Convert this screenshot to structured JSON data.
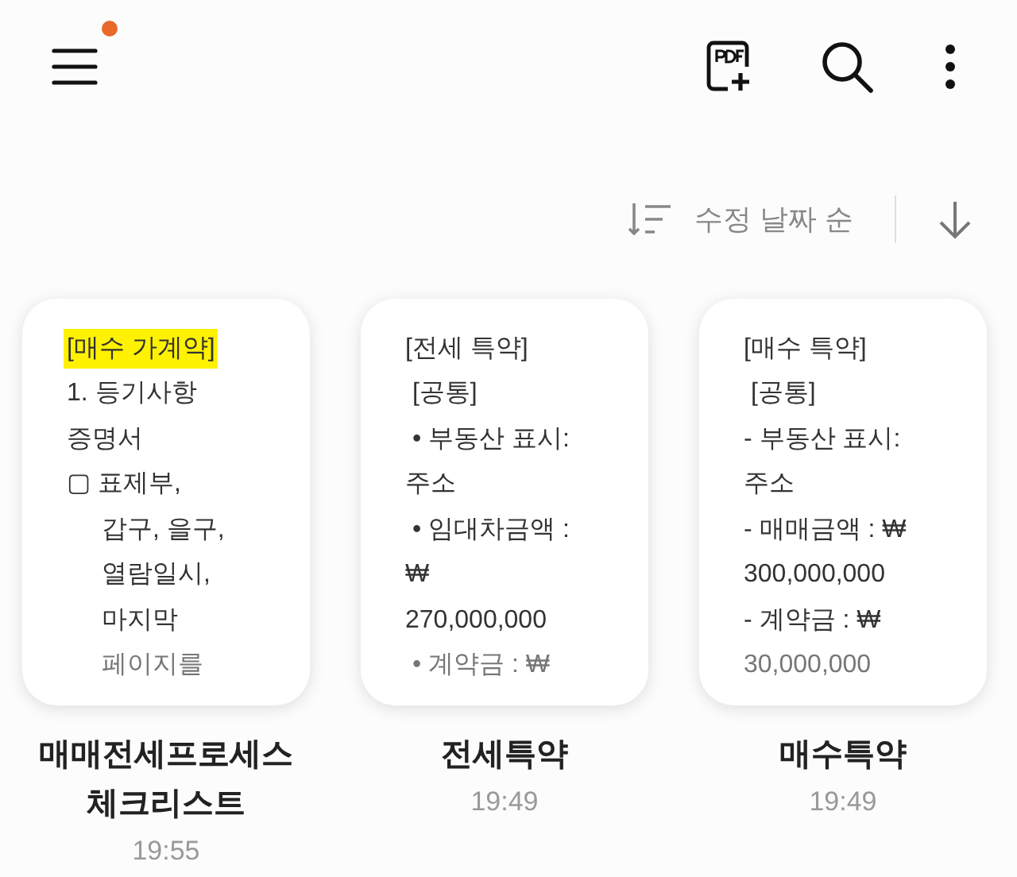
{
  "menu": {
    "notification": true
  },
  "sort": {
    "label": "수정 날짜 순"
  },
  "notes": [
    {
      "lines": [
        {
          "text": "[매수 가계약]",
          "highlighted": true
        },
        {
          "text": "1. 등기사항",
          "highlighted": false
        },
        {
          "text": "증명서",
          "highlighted": false
        },
        {
          "text": "▢ 표제부,",
          "highlighted": false,
          "children": [
            {
              "text": "갑구, 을구,",
              "highlighted": false
            },
            {
              "text": "열람일시,",
              "highlighted": false
            },
            {
              "text": "마지막",
              "highlighted": false
            },
            {
              "text": "페이지를",
              "highlighted": false
            }
          ]
        }
      ],
      "title": "매매전세프로세스 체크리스트",
      "time": "19:55"
    },
    {
      "lines": [
        {
          "text": "[전세 특약]",
          "highlighted": false
        },
        {
          "text": " [공통]",
          "highlighted": false
        },
        {
          "text": " • 부동산 표시:",
          "highlighted": false
        },
        {
          "text": "주소",
          "highlighted": false
        },
        {
          "text": " • 임대차금액 :",
          "highlighted": false
        },
        {
          "text": "₩",
          "highlighted": false
        },
        {
          "text": "270,000,000",
          "highlighted": false
        },
        {
          "text": " • 계약금 : ₩",
          "highlighted": false
        }
      ],
      "title": "전세특약",
      "time": "19:49"
    },
    {
      "lines": [
        {
          "text": "[매수 특약]",
          "highlighted": false
        },
        {
          "text": " [공통]",
          "highlighted": false
        },
        {
          "text": "- 부동산 표시:",
          "highlighted": false
        },
        {
          "text": "주소",
          "highlighted": false
        },
        {
          "text": "- 매매금액 : ₩",
          "highlighted": false
        },
        {
          "text": "300,000,000",
          "highlighted": false
        },
        {
          "text": "- 계약금 : ₩",
          "highlighted": false
        },
        {
          "text": "30,000,000",
          "highlighted": false
        }
      ],
      "title": "매수특약",
      "time": "19:49"
    }
  ]
}
